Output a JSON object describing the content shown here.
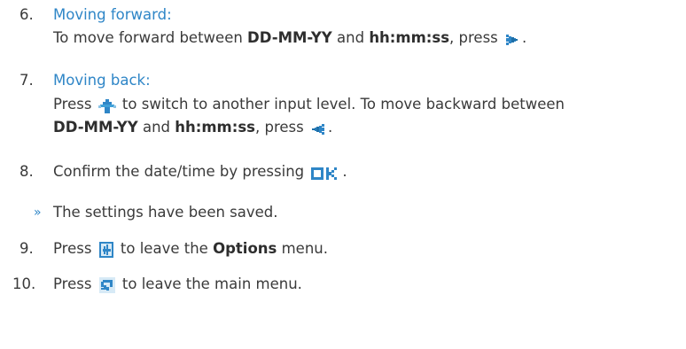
{
  "step6": {
    "number": "6.",
    "heading": "Moving forward:",
    "text_a": "To move forward between ",
    "bold_a": "DD-MM-YY",
    "text_b": " and ",
    "bold_b": "hh:mm:ss",
    "text_c": ", press ",
    "text_d": ".",
    "icon": "forward-arrow-icon"
  },
  "step7": {
    "number": "7.",
    "heading": "Moving back:",
    "text_a": "Press ",
    "text_b": " to switch to another input level. To move backward between",
    "bold_a": "DD-MM-YY",
    "text_c": " and ",
    "bold_b": "hh:mm:ss",
    "text_d": ", press ",
    "text_e": ".",
    "icon_level": "level-up-arrow-icon",
    "icon_back": "back-arrow-icon"
  },
  "step8": {
    "number": "8.",
    "text_a": "Confirm the date/time by pressing ",
    "text_b": ".",
    "icon": "ok-icon"
  },
  "result": {
    "marker": "»",
    "text": "The settings have been saved."
  },
  "step9": {
    "number": "9.",
    "text_a": "Press ",
    "text_b": " to leave the ",
    "bold_a": "Options",
    "text_c": " menu.",
    "icon": "exit-menu-icon"
  },
  "step10": {
    "number": "10.",
    "text_a": "Press ",
    "text_b": " to leave the main menu.",
    "icon": "return-icon"
  },
  "colors": {
    "heading": "#2f86c7",
    "text": "#3a3a3a",
    "icon_blue": "#2f86c7"
  }
}
